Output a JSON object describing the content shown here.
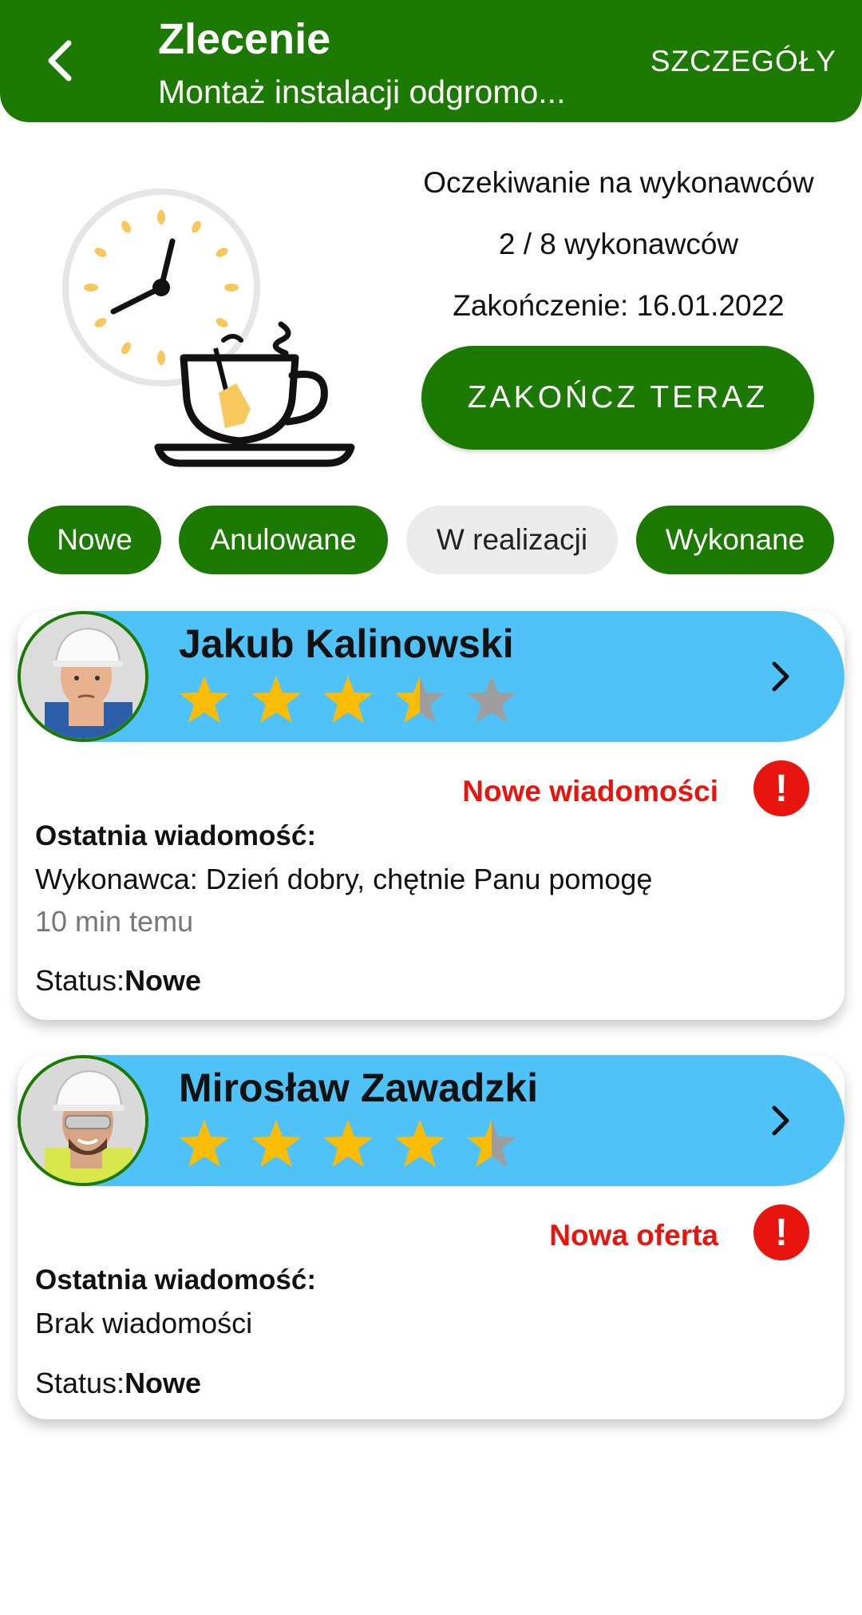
{
  "header": {
    "title": "Zlecenie",
    "subtitle": "Montaż instalacji odgromo...",
    "details_label": "SZCZEGÓŁY",
    "color": "#1c7a02"
  },
  "status_panel": {
    "waiting": "Oczekiwanie na wykonawców",
    "count": "2 / 8 wykonawców",
    "finish_date": "Zakończenie:  16.01.2022",
    "finish_button": "ZAKOŃCZ TERAZ"
  },
  "filters": [
    {
      "label": "Nowe",
      "active": true
    },
    {
      "label": "Anulowane",
      "active": true
    },
    {
      "label": "W realizacji",
      "active": false
    },
    {
      "label": "Wykonane",
      "active": true
    }
  ],
  "contractors": [
    {
      "name": "Jakub Kalinowski",
      "rating": 3.5,
      "alert": "Nowe wiadomości",
      "last_message_label": "Ostatnia wiadomość:",
      "last_message": "Wykonawca: Dzień dobry, chętnie Panu pomogę",
      "time": "10 min temu",
      "status_label": "Status:",
      "status_value": "Nowe"
    },
    {
      "name": "Mirosław Zawadzki",
      "rating": 4.5,
      "alert": "Nowa oferta",
      "last_message_label": "Ostatnia wiadomość:",
      "last_message": "Brak wiadomości",
      "status_label": "Status:",
      "status_value": "Nowe"
    }
  ],
  "colors": {
    "accent_green": "#1c7a02",
    "card_header_blue": "#4fc3f7",
    "alert_red": "#e8150e",
    "star_gold": "#fbbc05",
    "star_gray": "#9e9e9e"
  },
  "icons": [
    "back-arrow-icon",
    "clock-icon",
    "teacup-icon",
    "star-icon",
    "chevron-right-icon",
    "exclamation-icon"
  ]
}
